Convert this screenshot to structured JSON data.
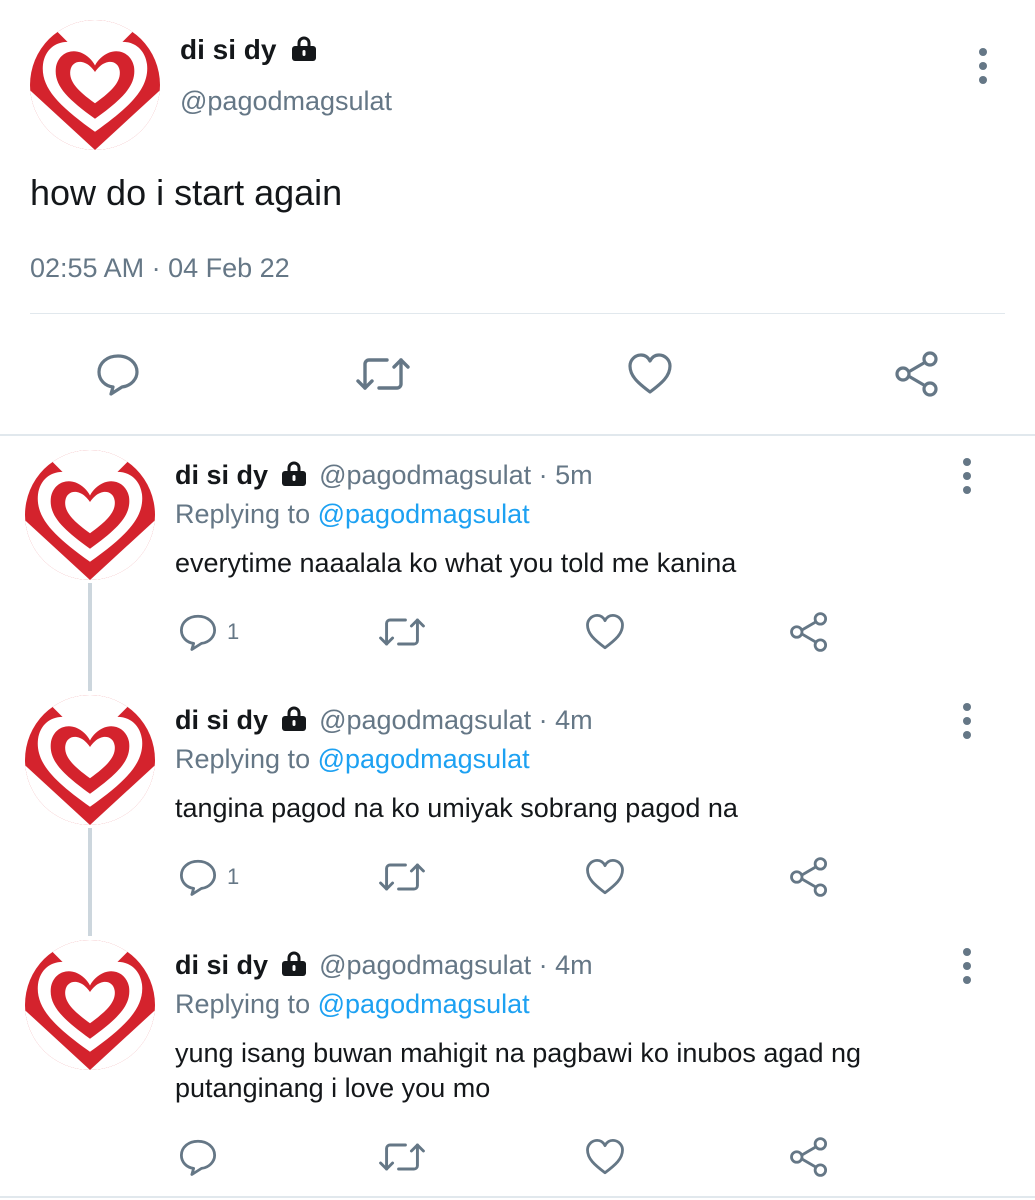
{
  "colors": {
    "accent": "#1da1f2",
    "muted": "#657786",
    "icon": "#657786",
    "heart_red": "#d4232d"
  },
  "main_tweet": {
    "display_name": "di si dy",
    "handle": "@pagodmagsulat",
    "text": "how do i start again",
    "timestamp": "02:55 AM · 04 Feb 22",
    "icons": [
      "reply-icon",
      "retweet-icon",
      "like-icon",
      "share-icon"
    ]
  },
  "replies": [
    {
      "display_name": "di si dy",
      "handle": "@pagodmagsulat",
      "sep": "·",
      "time": "5m",
      "replying_label": "Replying to",
      "replying_to": "@pagodmagsulat",
      "text_lines": [
        "everytime naaalala ko what you told me kanina"
      ],
      "reply_count": "1"
    },
    {
      "display_name": "di si dy",
      "handle": "@pagodmagsulat",
      "sep": "·",
      "time": "4m",
      "replying_label": "Replying to",
      "replying_to": "@pagodmagsulat",
      "text_lines": [
        "tangina pagod na ko umiyak sobrang pagod na"
      ],
      "reply_count": "1"
    },
    {
      "display_name": "di si dy",
      "handle": "@pagodmagsulat",
      "sep": "·",
      "time": "4m",
      "replying_label": "Replying to",
      "replying_to": "@pagodmagsulat",
      "text_lines": [
        "yung isang buwan mahigit na pagbawi ko inubos agad ng",
        "putanginang i love you mo"
      ],
      "reply_count": ""
    }
  ]
}
